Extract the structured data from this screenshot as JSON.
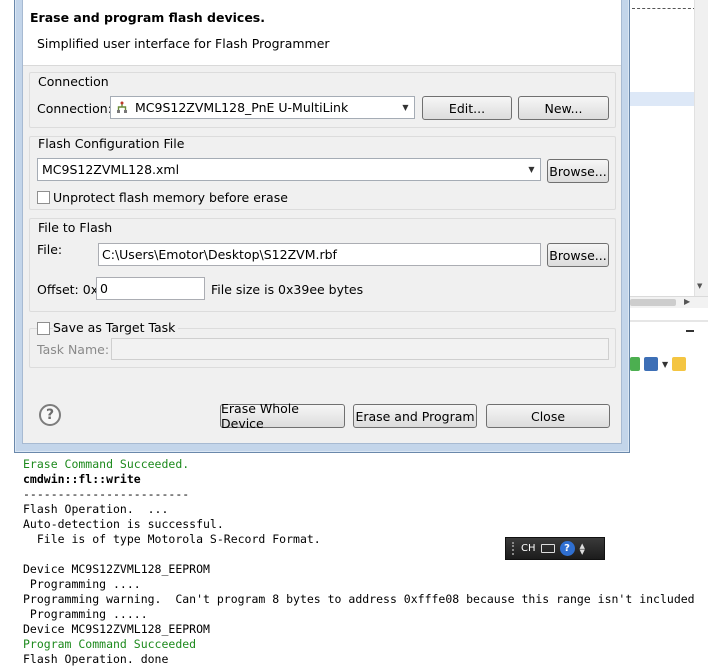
{
  "dialog": {
    "title": "Erase and program flash devices.",
    "description": "Simplified user interface for Flash Programmer",
    "connection": {
      "group_label": "Connection",
      "field_label": "Connection:",
      "value": "MC9S12ZVML128_PnE U-MultiLink",
      "edit_label": "Edit...",
      "new_label": "New..."
    },
    "flash_config": {
      "group_label": "Flash Configuration File",
      "value": "MC9S12ZVML128.xml",
      "browse_label": "Browse...",
      "unprotect_label": "Unprotect flash memory before erase",
      "unprotect_checked": false
    },
    "file_to_flash": {
      "group_label": "File to Flash",
      "file_label": "File:",
      "file_value": "C:\\Users\\Emotor\\Desktop\\S12ZVM.rbf",
      "browse_label": "Browse...",
      "offset_label": "Offset: 0x",
      "offset_value": "0",
      "file_size_text": "File size is 0x39ee bytes"
    },
    "target_task": {
      "save_label": "Save as Target Task",
      "save_checked": false,
      "task_name_label": "Task Name:",
      "task_name_value": ""
    },
    "buttons": {
      "erase_whole": "Erase Whole Device",
      "erase_program": "Erase and Program",
      "close": "Close"
    },
    "help_icon": "help-icon"
  },
  "console": {
    "lines": [
      {
        "text": "Erase Command Succeeded.",
        "style": "green"
      },
      {
        "text": "cmdwin::fl::write",
        "style": "bold"
      },
      {
        "text": "------------------------",
        "style": "normal"
      },
      {
        "text": "Flash Operation.  ...",
        "style": "normal"
      },
      {
        "text": "Auto-detection is successful.",
        "style": "normal"
      },
      {
        "text": "  File is of type Motorola S-Record Format.",
        "style": "normal"
      },
      {
        "text": "",
        "style": "normal"
      },
      {
        "text": "Device MC9S12ZVML128_EEPROM",
        "style": "normal"
      },
      {
        "text": " Programming ....",
        "style": "normal"
      },
      {
        "text": "Programming warning.  Can't program 8 bytes to address 0xfffe08 because this range isn't included",
        "style": "normal"
      },
      {
        "text": " Programming .....",
        "style": "normal"
      },
      {
        "text": "Device MC9S12ZVML128_EEPROM",
        "style": "normal"
      },
      {
        "text": "Program Command Succeeded",
        "style": "green"
      },
      {
        "text": "Flash Operation. done",
        "style": "normal"
      }
    ]
  },
  "ime_bar": {
    "language": "CH",
    "icons": [
      "keyboard-icon",
      "help-icon",
      "options-arrows-icon"
    ]
  },
  "colors": {
    "success_green": "#1d8a1d",
    "dialog_frame": "#c3d5ea",
    "dialog_body": "#f0f0f0"
  }
}
